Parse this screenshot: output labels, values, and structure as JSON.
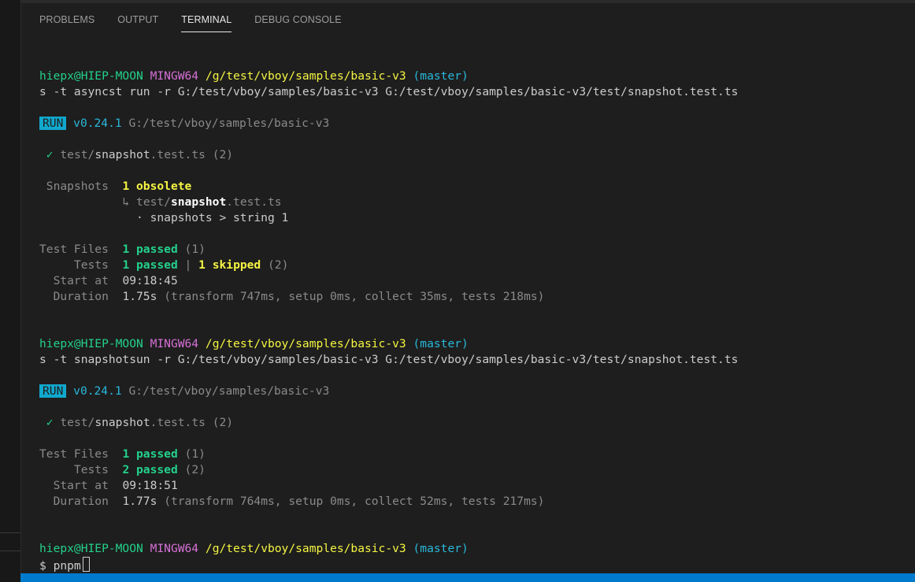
{
  "tabs": [
    {
      "label": "PROBLEMS"
    },
    {
      "label": "OUTPUT"
    },
    {
      "label": "TERMINAL",
      "active": true
    },
    {
      "label": "DEBUG CONSOLE"
    }
  ],
  "runs": [
    {
      "prompt": {
        "user": "hiepx@HIEP-MOON",
        "system": "MINGW64",
        "path": "/g/test/vboy/samples/basic-v3",
        "branch": "(master)"
      },
      "command": "s -t asyncst run -r G:/test/vboy/samples/basic-v3 G:/test/vboy/samples/basic-v3/test/snapshot.test.ts",
      "run_badge": "RUN",
      "version": "v0.24.1",
      "root": "G:/test/vboy/samples/basic-v3",
      "file": {
        "check": "✓",
        "dir": "test/",
        "name": "snapshot",
        "ext": ".test.ts",
        "count": "(2)"
      },
      "snapshots": {
        "label": "Snapshots",
        "summary": "1 obsolete",
        "arrow": "↳",
        "file_dir": "test/",
        "file_name": "snapshot",
        "file_ext": ".test.ts",
        "detail": "· snapshots > string 1"
      },
      "summary": {
        "test_files_label": "Test Files",
        "test_files_passed": "1 passed",
        "test_files_total": "(1)",
        "tests_label": "Tests",
        "tests_passed": "1 passed",
        "tests_sep": "|",
        "tests_skipped": "1 skipped",
        "tests_total": "(2)",
        "start_label": "Start at",
        "start_value": "09:18:45",
        "duration_label": "Duration",
        "duration_value": "1.75s",
        "duration_detail": "(transform 747ms, setup 0ms, collect 35ms, tests 218ms)"
      }
    },
    {
      "prompt": {
        "user": "hiepx@HIEP-MOON",
        "system": "MINGW64",
        "path": "/g/test/vboy/samples/basic-v3",
        "branch": "(master)"
      },
      "command": "s -t snapshotsun -r G:/test/vboy/samples/basic-v3 G:/test/vboy/samples/basic-v3/test/snapshot.test.ts",
      "run_badge": "RUN",
      "version": "v0.24.1",
      "root": "G:/test/vboy/samples/basic-v3",
      "file": {
        "check": "✓",
        "dir": "test/",
        "name": "snapshot",
        "ext": ".test.ts",
        "count": "(2)"
      },
      "summary": {
        "test_files_label": "Test Files",
        "test_files_passed": "1 passed",
        "test_files_total": "(1)",
        "tests_label": "Tests",
        "tests_passed": "2 passed",
        "tests_total": "(2)",
        "start_label": "Start at",
        "start_value": "09:18:51",
        "duration_label": "Duration",
        "duration_value": "1.77s",
        "duration_detail": "(transform 764ms, setup 0ms, collect 52ms, tests 217ms)"
      }
    }
  ],
  "final_prompt": {
    "user": "hiepx@HIEP-MOON",
    "system": "MINGW64",
    "path": "/g/test/vboy/samples/basic-v3",
    "branch": "(master)"
  },
  "input_line": {
    "prefix": "$",
    "text": "pnpm"
  },
  "colors": {
    "statusbar": "#007acc",
    "green": "#23d18b",
    "magenta": "#d670d6",
    "yellow": "#f5f543",
    "cyan": "#29b8db"
  }
}
